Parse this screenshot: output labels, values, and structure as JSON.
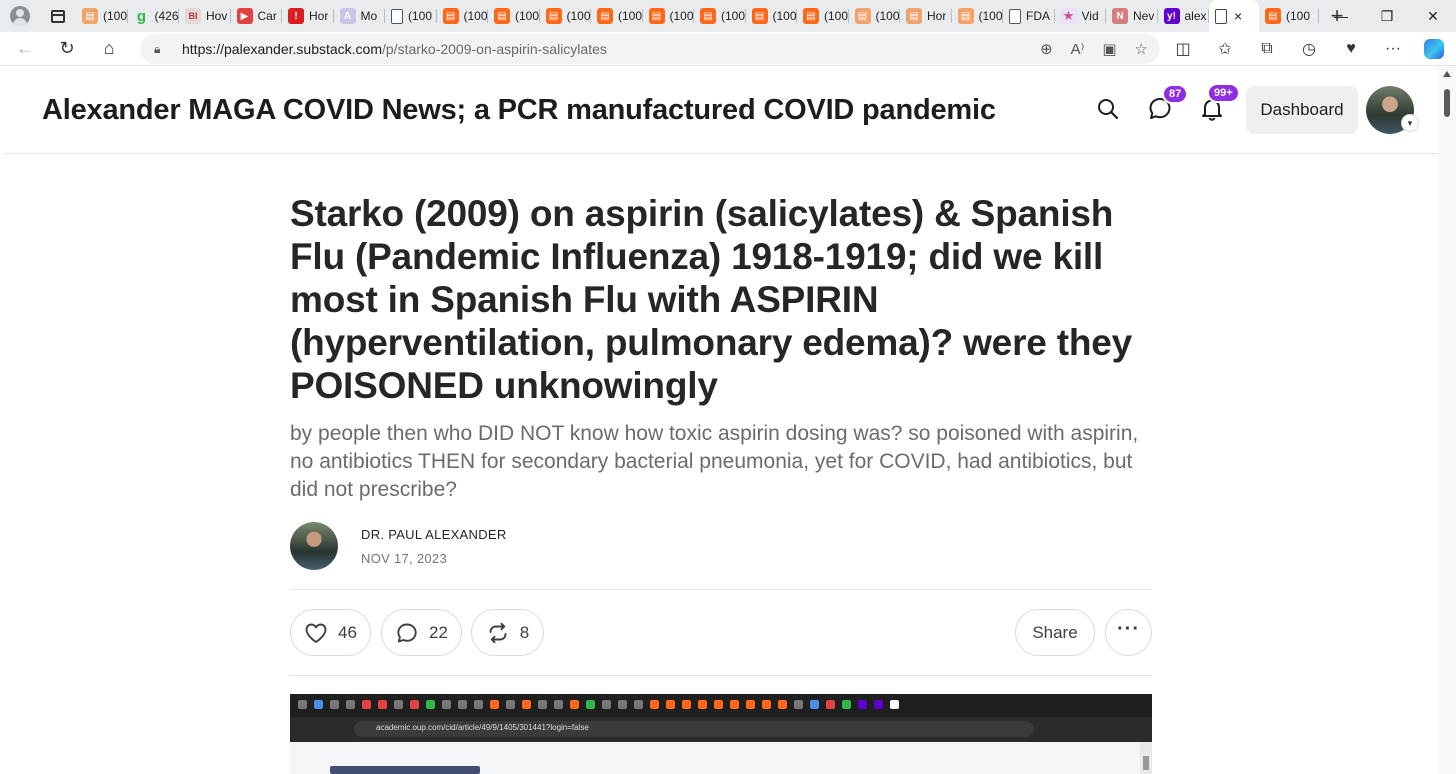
{
  "browser": {
    "tabs": [
      {
        "label": "(100",
        "favicon": "bookmark-orange",
        "color": "#f0a36b"
      },
      {
        "label": "(426",
        "favicon": "g-green",
        "color": "#2fb94a"
      },
      {
        "label": "Hov",
        "favicon": "bi-logo",
        "color": "#e7d8d8"
      },
      {
        "label": "Car",
        "favicon": "youtube",
        "color": "#e34141"
      },
      {
        "label": "Hor",
        "favicon": "alert-red",
        "color": "#d92020"
      },
      {
        "label": "Mo",
        "favicon": "ai-logo",
        "color": "#c8c6e8"
      },
      {
        "label": "(100",
        "favicon": "doc",
        "color": "#ffffff"
      },
      {
        "label": "(100",
        "favicon": "substack",
        "color": "#ff6719"
      },
      {
        "label": "(100",
        "favicon": "substack",
        "color": "#ff6719"
      },
      {
        "label": "(100",
        "favicon": "substack",
        "color": "#ff6719"
      },
      {
        "label": "(100",
        "favicon": "substack",
        "color": "#ff6719"
      },
      {
        "label": "(100",
        "favicon": "substack",
        "color": "#ff6719"
      },
      {
        "label": "(100",
        "favicon": "substack",
        "color": "#ff6719"
      },
      {
        "label": "(100",
        "favicon": "substack",
        "color": "#ff6719"
      },
      {
        "label": "(100",
        "favicon": "substack",
        "color": "#ff6719"
      },
      {
        "label": "(100",
        "favicon": "bookmark-orange",
        "color": "#f0a36b"
      },
      {
        "label": "Hor",
        "favicon": "bookmark-orange",
        "color": "#f0a36b"
      },
      {
        "label": "(100",
        "favicon": "bookmark-orange",
        "color": "#f0a36b"
      },
      {
        "label": "FDA",
        "favicon": "doc",
        "color": "#ffffff"
      },
      {
        "label": "Vid",
        "favicon": "star",
        "color": "#e8e2f4"
      },
      {
        "label": "Nev",
        "favicon": "news",
        "color": "#d77d7d"
      },
      {
        "label": "alex",
        "favicon": "yahoo",
        "color": "#6001d2"
      }
    ],
    "active_tab": {
      "favicon": "doc",
      "close": "×"
    },
    "last_tab": {
      "label": "(100",
      "favicon": "substack",
      "color": "#ff6719"
    },
    "new_tab": "+",
    "url_host": "https://palexander.substack.com",
    "url_path": "/p/starko-2009-on-aspirin-salicylates"
  },
  "site": {
    "title": "Alexander MAGA COVID News; a PCR manufactured COVID pandemic",
    "chat_badge": "87",
    "notif_badge": "99+",
    "dashboard_label": "Dashboard",
    "badge_color": "#8e2de2"
  },
  "post": {
    "title": "Starko (2009) on aspirin (salicylates) & Spanish Flu (Pandemic Influenza) 1918-1919; did we kill most in Spanish Flu with ASPIRIN (hyperventilation, pulmonary edema)? were they POISONED unknowingly",
    "subtitle": "by people then who DID NOT know how toxic aspirin dosing was? so poisoned with aspirin, no antibiotics THEN for secondary bacterial pneumonia, yet for COVID, had antibiotics, but did not prescribe?",
    "author": "DR. PAUL ALEXANDER",
    "date": "NOV 17, 2023",
    "likes": "46",
    "comments": "22",
    "restacks": "8",
    "share_label": "Share"
  },
  "embedded_screenshot": {
    "url": "academic.oup.com/cid/article/49/9/1405/301441?login=false"
  }
}
